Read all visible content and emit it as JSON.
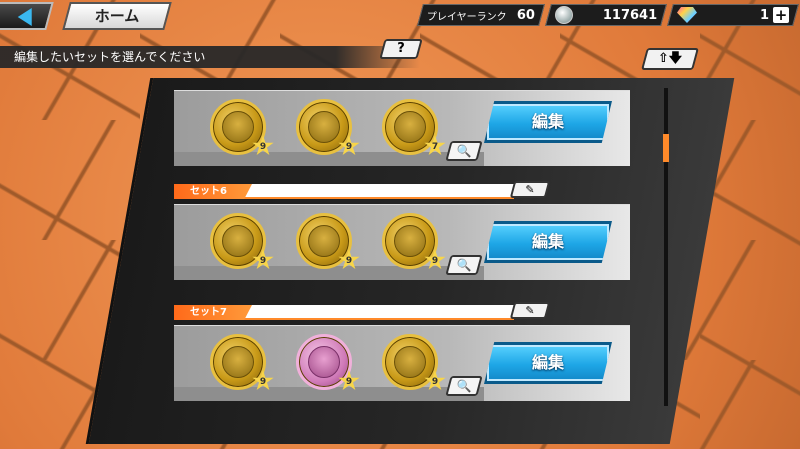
{
  "header": {
    "home_label": "ホーム",
    "player_rank_label": "プレイヤーランク",
    "player_rank_value": "60",
    "coins_value": "117641",
    "gems_value": "1",
    "plus_label": "+"
  },
  "instruction": "編集したいセットを選んでください",
  "help_label": "?",
  "sort_label": "⇧🡇",
  "sets": [
    {
      "label": "",
      "medals": [
        {
          "type": "gold",
          "stars": "9"
        },
        {
          "type": "gold",
          "stars": "9"
        },
        {
          "type": "gold",
          "stars": "7"
        }
      ],
      "edit_label": "編集",
      "magnify_label": "🔍"
    },
    {
      "label": "セット6",
      "medals": [
        {
          "type": "gold",
          "stars": "9"
        },
        {
          "type": "gold",
          "stars": "9"
        },
        {
          "type": "gold",
          "stars": "9"
        }
      ],
      "edit_label": "編集",
      "magnify_label": "🔍",
      "rename_label": "✎"
    },
    {
      "label": "セット7",
      "medals": [
        {
          "type": "gold",
          "stars": "9"
        },
        {
          "type": "pink",
          "stars": "9"
        },
        {
          "type": "gold",
          "stars": "9"
        }
      ],
      "edit_label": "編集",
      "magnify_label": "🔍",
      "rename_label": "✎"
    }
  ],
  "colors": {
    "accent_orange": "#ff8a2a",
    "edit_blue": "#1ea6e6",
    "background_orange": "#e8884a"
  }
}
